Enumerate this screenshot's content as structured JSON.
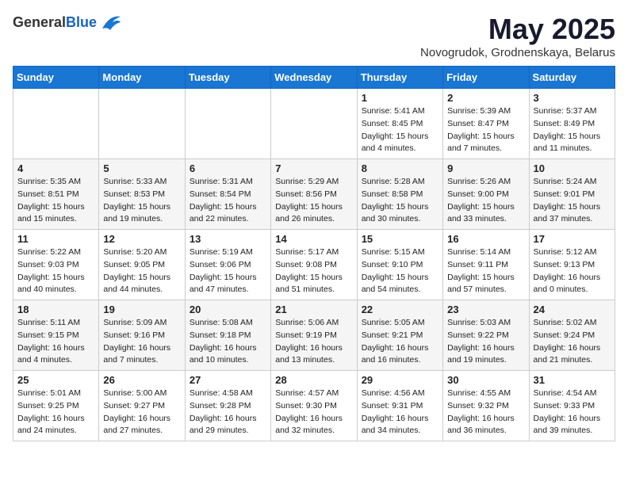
{
  "header": {
    "logo_general": "General",
    "logo_blue": "Blue",
    "month_year": "May 2025",
    "location": "Novogrudok, Grodnenskaya, Belarus"
  },
  "weekdays": [
    "Sunday",
    "Monday",
    "Tuesday",
    "Wednesday",
    "Thursday",
    "Friday",
    "Saturday"
  ],
  "weeks": [
    [
      {
        "day": "",
        "info": ""
      },
      {
        "day": "",
        "info": ""
      },
      {
        "day": "",
        "info": ""
      },
      {
        "day": "",
        "info": ""
      },
      {
        "day": "1",
        "info": "Sunrise: 5:41 AM\nSunset: 8:45 PM\nDaylight: 15 hours\nand 4 minutes."
      },
      {
        "day": "2",
        "info": "Sunrise: 5:39 AM\nSunset: 8:47 PM\nDaylight: 15 hours\nand 7 minutes."
      },
      {
        "day": "3",
        "info": "Sunrise: 5:37 AM\nSunset: 8:49 PM\nDaylight: 15 hours\nand 11 minutes."
      }
    ],
    [
      {
        "day": "4",
        "info": "Sunrise: 5:35 AM\nSunset: 8:51 PM\nDaylight: 15 hours\nand 15 minutes."
      },
      {
        "day": "5",
        "info": "Sunrise: 5:33 AM\nSunset: 8:53 PM\nDaylight: 15 hours\nand 19 minutes."
      },
      {
        "day": "6",
        "info": "Sunrise: 5:31 AM\nSunset: 8:54 PM\nDaylight: 15 hours\nand 22 minutes."
      },
      {
        "day": "7",
        "info": "Sunrise: 5:29 AM\nSunset: 8:56 PM\nDaylight: 15 hours\nand 26 minutes."
      },
      {
        "day": "8",
        "info": "Sunrise: 5:28 AM\nSunset: 8:58 PM\nDaylight: 15 hours\nand 30 minutes."
      },
      {
        "day": "9",
        "info": "Sunrise: 5:26 AM\nSunset: 9:00 PM\nDaylight: 15 hours\nand 33 minutes."
      },
      {
        "day": "10",
        "info": "Sunrise: 5:24 AM\nSunset: 9:01 PM\nDaylight: 15 hours\nand 37 minutes."
      }
    ],
    [
      {
        "day": "11",
        "info": "Sunrise: 5:22 AM\nSunset: 9:03 PM\nDaylight: 15 hours\nand 40 minutes."
      },
      {
        "day": "12",
        "info": "Sunrise: 5:20 AM\nSunset: 9:05 PM\nDaylight: 15 hours\nand 44 minutes."
      },
      {
        "day": "13",
        "info": "Sunrise: 5:19 AM\nSunset: 9:06 PM\nDaylight: 15 hours\nand 47 minutes."
      },
      {
        "day": "14",
        "info": "Sunrise: 5:17 AM\nSunset: 9:08 PM\nDaylight: 15 hours\nand 51 minutes."
      },
      {
        "day": "15",
        "info": "Sunrise: 5:15 AM\nSunset: 9:10 PM\nDaylight: 15 hours\nand 54 minutes."
      },
      {
        "day": "16",
        "info": "Sunrise: 5:14 AM\nSunset: 9:11 PM\nDaylight: 15 hours\nand 57 minutes."
      },
      {
        "day": "17",
        "info": "Sunrise: 5:12 AM\nSunset: 9:13 PM\nDaylight: 16 hours\nand 0 minutes."
      }
    ],
    [
      {
        "day": "18",
        "info": "Sunrise: 5:11 AM\nSunset: 9:15 PM\nDaylight: 16 hours\nand 4 minutes."
      },
      {
        "day": "19",
        "info": "Sunrise: 5:09 AM\nSunset: 9:16 PM\nDaylight: 16 hours\nand 7 minutes."
      },
      {
        "day": "20",
        "info": "Sunrise: 5:08 AM\nSunset: 9:18 PM\nDaylight: 16 hours\nand 10 minutes."
      },
      {
        "day": "21",
        "info": "Sunrise: 5:06 AM\nSunset: 9:19 PM\nDaylight: 16 hours\nand 13 minutes."
      },
      {
        "day": "22",
        "info": "Sunrise: 5:05 AM\nSunset: 9:21 PM\nDaylight: 16 hours\nand 16 minutes."
      },
      {
        "day": "23",
        "info": "Sunrise: 5:03 AM\nSunset: 9:22 PM\nDaylight: 16 hours\nand 19 minutes."
      },
      {
        "day": "24",
        "info": "Sunrise: 5:02 AM\nSunset: 9:24 PM\nDaylight: 16 hours\nand 21 minutes."
      }
    ],
    [
      {
        "day": "25",
        "info": "Sunrise: 5:01 AM\nSunset: 9:25 PM\nDaylight: 16 hours\nand 24 minutes."
      },
      {
        "day": "26",
        "info": "Sunrise: 5:00 AM\nSunset: 9:27 PM\nDaylight: 16 hours\nand 27 minutes."
      },
      {
        "day": "27",
        "info": "Sunrise: 4:58 AM\nSunset: 9:28 PM\nDaylight: 16 hours\nand 29 minutes."
      },
      {
        "day": "28",
        "info": "Sunrise: 4:57 AM\nSunset: 9:30 PM\nDaylight: 16 hours\nand 32 minutes."
      },
      {
        "day": "29",
        "info": "Sunrise: 4:56 AM\nSunset: 9:31 PM\nDaylight: 16 hours\nand 34 minutes."
      },
      {
        "day": "30",
        "info": "Sunrise: 4:55 AM\nSunset: 9:32 PM\nDaylight: 16 hours\nand 36 minutes."
      },
      {
        "day": "31",
        "info": "Sunrise: 4:54 AM\nSunset: 9:33 PM\nDaylight: 16 hours\nand 39 minutes."
      }
    ]
  ]
}
